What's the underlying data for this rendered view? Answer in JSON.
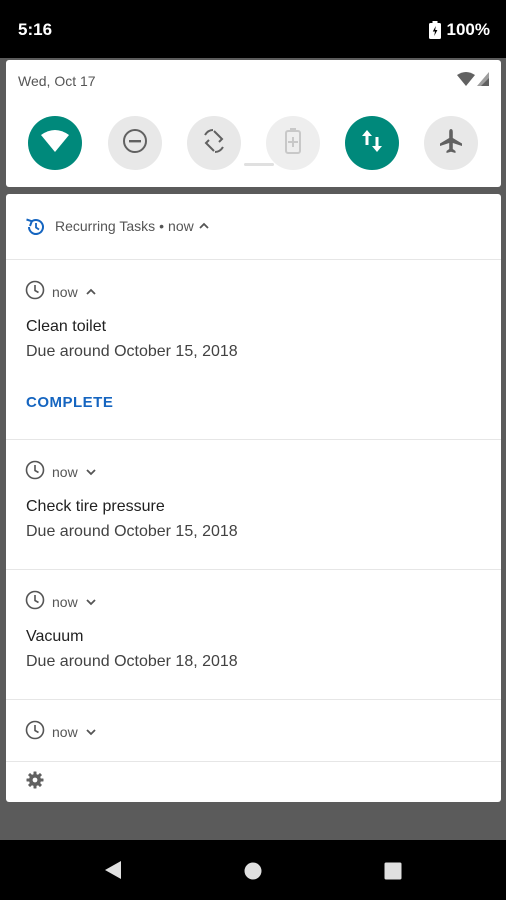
{
  "status_bar": {
    "time": "5:16",
    "battery": "100%"
  },
  "quick_settings": {
    "date": "Wed, Oct 17",
    "tiles": [
      {
        "name": "wifi",
        "state": "on"
      },
      {
        "name": "do-not-disturb",
        "state": "off"
      },
      {
        "name": "auto-rotate",
        "state": "off"
      },
      {
        "name": "battery-saver",
        "state": "disabled"
      },
      {
        "name": "mobile-data",
        "state": "on"
      },
      {
        "name": "airplane-mode",
        "state": "off"
      }
    ]
  },
  "notifications": {
    "group": {
      "app_name": "Recurring Tasks",
      "separator": "•",
      "time": "now"
    },
    "items": [
      {
        "time": "now",
        "expanded": true,
        "title": "Clean toilet",
        "subtitle": "Due around October 15, 2018",
        "action": "COMPLETE"
      },
      {
        "time": "now",
        "expanded": false,
        "title": "Check tire pressure",
        "subtitle": "Due around October 15, 2018"
      },
      {
        "time": "now",
        "expanded": false,
        "title": "Vacuum",
        "subtitle": "Due around October 18, 2018"
      },
      {
        "time": "now",
        "expanded": false
      }
    ]
  },
  "colors": {
    "accent": "#00897b",
    "action": "#1565c0"
  }
}
